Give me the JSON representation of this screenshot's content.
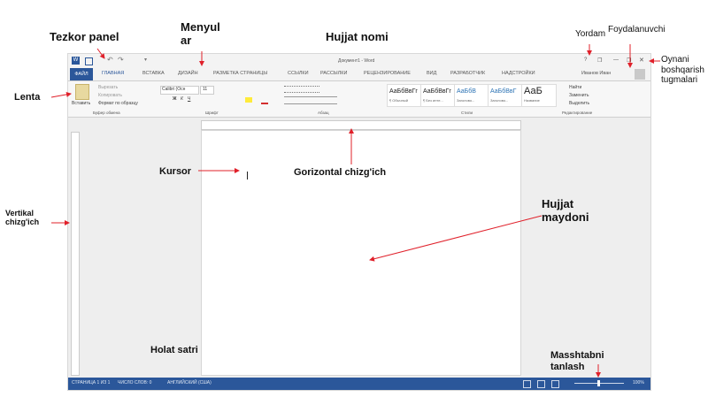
{
  "labels": {
    "quick_access": "Tezkor panel",
    "menus": "Menyul ar",
    "doc_name": "Hujjat nomi",
    "help": "Yordam",
    "user": "Foydalanuvchi",
    "window_controls": "Oynani boshqarish tugmalari",
    "ribbon": "Lenta",
    "cursor": "Kursor",
    "h_ruler": "Gorizontal chizg'ich",
    "v_ruler": "Vertikal chizg'ich",
    "doc_area": "Hujjat maydoni",
    "status_bar": "Holat satri",
    "zoom": "Masshtabni tanlash"
  },
  "window": {
    "title": "Документ1 - Word",
    "user_name": "Иванов Иван",
    "controls": [
      "?",
      "❐",
      "—",
      "❐",
      "✕"
    ]
  },
  "tabs": [
    "ФАЙЛ",
    "ГЛАВНАЯ",
    "ВСТАВКА",
    "ДИЗАЙН",
    "РАЗМЕТКА СТРАНИЦЫ",
    "ССЫЛКИ",
    "РАССЫЛКИ",
    "РЕЦЕНЗИРОВАНИЕ",
    "ВИД",
    "РАЗРАБОТЧИК",
    "НАДСТРОЙКИ"
  ],
  "ribbon": {
    "clipboard": {
      "label": "Буфер обмена",
      "paste": "Вставить",
      "cut": "Вырезать",
      "copy": "Копировать",
      "format": "Формат по образцу"
    },
    "font": {
      "label": "Шрифт",
      "name": "Calibri (Осн",
      "size": "11"
    },
    "paragraph": {
      "label": "Абзац"
    },
    "styles": {
      "label": "Стили",
      "items": [
        {
          "sample": "АаБбВвГг",
          "name": "¶ Обычный"
        },
        {
          "sample": "АаБбВвГг",
          "name": "¶ Без инте..."
        },
        {
          "sample": "АаБбВ",
          "name": "Заголово..."
        },
        {
          "sample": "АаБбВвГ",
          "name": "Заголово..."
        },
        {
          "sample": "АаБ",
          "name": "Название"
        }
      ]
    },
    "editing": {
      "label": "Редактирование",
      "find": "Найти",
      "replace": "Заменить",
      "select": "Выделить"
    }
  },
  "status": {
    "page": "СТРАНИЦА 1 ИЗ 1",
    "words": "ЧИСЛО СЛОВ: 0",
    "lang": "АНГЛИЙСКИЙ (США)",
    "zoom": "100%"
  },
  "colors": {
    "accent": "#2b579a",
    "arrow": "#e0202a"
  }
}
